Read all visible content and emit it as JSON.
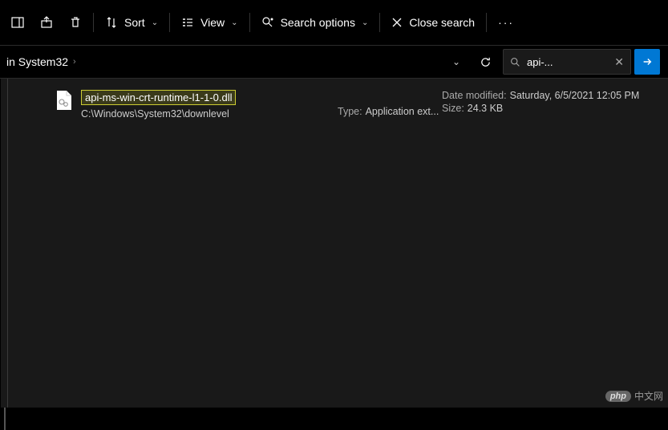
{
  "toolbar": {
    "sort_label": "Sort",
    "view_label": "View",
    "search_options_label": "Search options",
    "close_search_label": "Close search",
    "more_label": "···"
  },
  "breadcrumb": {
    "text": "in System32"
  },
  "search": {
    "query": "api-..."
  },
  "result": {
    "filename": "api-ms-win-crt-runtime-l1-1-0.dll",
    "path": "C:\\Windows\\System32\\downlevel",
    "type_label": "Type:",
    "type_value": "Application ext...",
    "date_label": "Date modified:",
    "date_value": "Saturday, 6/5/2021 12:05 PM",
    "size_label": "Size:",
    "size_value": "24.3 KB"
  },
  "watermark": {
    "brand": "php",
    "text": "中文网"
  }
}
